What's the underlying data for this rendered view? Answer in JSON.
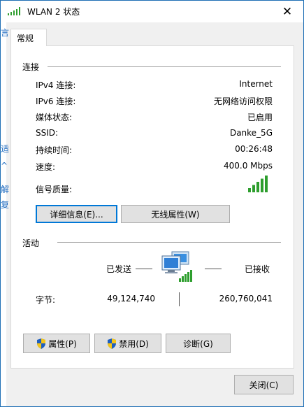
{
  "window": {
    "title": "WLAN 2 状态",
    "close_icon": "close-icon",
    "wifi_icon": "wifi-signal-icon"
  },
  "background_window": {
    "fragments": [
      "言",
      "适",
      "^",
      "解",
      "复"
    ]
  },
  "tabs": [
    {
      "label": "常规"
    }
  ],
  "connection": {
    "section_title": "连接",
    "rows": [
      {
        "label": "IPv4 连接:",
        "value": "Internet"
      },
      {
        "label": "IPv6 连接:",
        "value": "无网络访问权限"
      },
      {
        "label": "媒体状态:",
        "value": "已启用"
      },
      {
        "label": "SSID:",
        "value": "Danke_5G"
      },
      {
        "label": "持续时间:",
        "value": "00:26:48"
      },
      {
        "label": "速度:",
        "value": "400.0 Mbps"
      },
      {
        "label": "信号质量:",
        "signal_bars": 5,
        "signal_max": 5
      }
    ],
    "details_button": "详细信息(E)...",
    "wireless_button": "无线属性(W)"
  },
  "activity": {
    "section_title": "活动",
    "sent_label": "已发送",
    "received_label": "已接收",
    "bytes_label": "字节:",
    "bytes_sent": "49,124,740",
    "bytes_received": "260,760,041"
  },
  "bottom_buttons": {
    "properties": "属性(P)",
    "disable": "禁用(D)",
    "diagnose": "诊断(G)"
  },
  "footer": {
    "close_button": "关闭(C)"
  },
  "colors": {
    "accent": "#0078d7",
    "signal_green": "#2e9e2e",
    "link_blue": "#1d6ac0"
  }
}
